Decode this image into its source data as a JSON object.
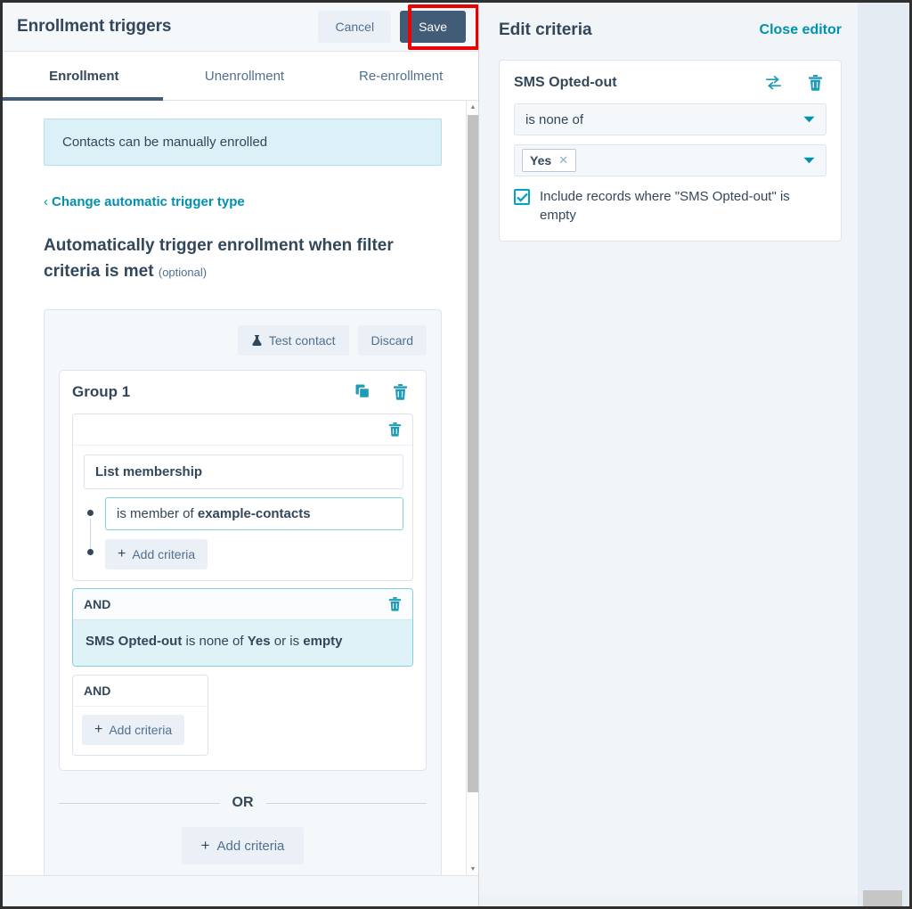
{
  "left": {
    "header": {
      "title": "Enrollment triggers",
      "cancel_label": "Cancel",
      "save_label": "Save"
    },
    "tabs": [
      {
        "label": "Enrollment",
        "active": true
      },
      {
        "label": "Unenrollment",
        "active": false
      },
      {
        "label": "Re-enrollment",
        "active": false
      }
    ],
    "banner_text": "Contacts can be manually enrolled",
    "change_trigger_link": "Change automatic trigger type",
    "section_heading": "Automatically trigger enrollment when filter criteria is met",
    "section_heading_optional": "(optional)",
    "toolbar": {
      "test_contact_label": "Test contact",
      "discard_label": "Discard"
    },
    "group": {
      "title": "Group 1",
      "filter": {
        "property_label": "List membership",
        "criteria_prefix": "is member of ",
        "criteria_value": "example-contacts",
        "add_criteria_label": "Add criteria"
      },
      "and_block": {
        "operator_label": "AND",
        "text_property": "SMS Opted-out",
        "text_middle": " is none of ",
        "text_value": "Yes",
        "text_suffix": " or is ",
        "text_end": "empty"
      },
      "and_empty": {
        "operator_label": "AND",
        "add_criteria_label": "Add criteria"
      }
    },
    "or_label": "OR",
    "or_add_criteria_label": "Add criteria"
  },
  "right": {
    "title": "Edit criteria",
    "close_editor_label": "Close editor",
    "criteria": {
      "property_name": "SMS Opted-out",
      "operator_value": "is none of",
      "token_value": "Yes",
      "include_empty_label": "Include records where \"SMS Opted-out\" is empty",
      "include_empty_checked": true
    }
  },
  "colors": {
    "brand_navy": "#33475b",
    "teal": "#00a4bd",
    "link_teal": "#0091ae",
    "primary_button": "#425b76",
    "highlight_red": "#ee0000",
    "panel_bg": "#f5f8fa",
    "banner_bg": "#dcf0f7"
  }
}
